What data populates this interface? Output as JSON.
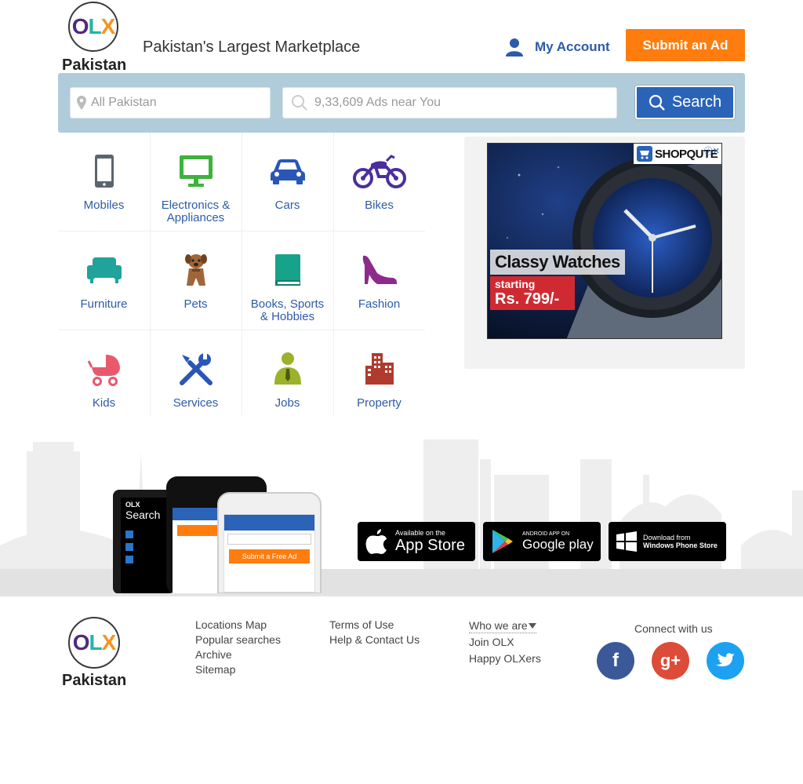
{
  "header": {
    "logo_text": "OLX",
    "country": "Pakistan",
    "tagline": "Pakistan's Largest Marketplace",
    "my_account": "My Account",
    "submit_ad": "Submit an Ad"
  },
  "search": {
    "location_placeholder": "All Pakistan",
    "query_placeholder": "9,33,609 Ads near You",
    "button_label": "Search"
  },
  "categories": [
    {
      "label": "Mobiles",
      "icon": "mobile-icon",
      "color": "#5a6670"
    },
    {
      "label": "Electronics &\nAppliances",
      "icon": "monitor-icon",
      "color": "#3fb23d"
    },
    {
      "label": "Cars",
      "icon": "car-icon",
      "color": "#2a56b6"
    },
    {
      "label": "Bikes",
      "icon": "motorbike-icon",
      "color": "#4b2f9c"
    },
    {
      "label": "Furniture",
      "icon": "sofa-icon",
      "color": "#1fa39a"
    },
    {
      "label": "Pets",
      "icon": "dog-icon",
      "color": "#a0663a"
    },
    {
      "label": "Books, Sports\n& Hobbies",
      "icon": "book-icon",
      "color": "#17a389"
    },
    {
      "label": "Fashion",
      "icon": "high-heel-icon",
      "color": "#8e2a8c"
    },
    {
      "label": "Kids",
      "icon": "stroller-icon",
      "color": "#e8596d"
    },
    {
      "label": "Services",
      "icon": "tools-icon",
      "color": "#2a56b6"
    },
    {
      "label": "Jobs",
      "icon": "worker-icon",
      "color": "#9bb22a"
    },
    {
      "label": "Property",
      "icon": "building-icon",
      "color": "#b03a2e"
    }
  ],
  "ad": {
    "brand": "SHOPQUTE",
    "headline": "Classy Watches",
    "sub": "starting",
    "price": "Rs. 799/-"
  },
  "apps": {
    "phone_search": "Search",
    "phone_submit": "Submit a Free Ad",
    "app_store_small": "Available on the",
    "app_store_big": "App Store",
    "google_small": "ANDROID APP ON",
    "google_big": "Google play",
    "windows_small": "Download from",
    "windows_big": "Windows Phone Store"
  },
  "footer": {
    "links_col1": [
      "Locations Map",
      "Popular searches",
      "Archive",
      "Sitemap"
    ],
    "links_col2": [
      "Terms of Use",
      "Help & Contact Us"
    ],
    "who_we_are": "Who we are",
    "links_col3": [
      "Join OLX",
      "Happy OLXers"
    ],
    "connect": "Connect with us",
    "social": [
      {
        "name": "facebook",
        "glyph": "f",
        "color": "#3b5998"
      },
      {
        "name": "google-plus",
        "glyph": "g+",
        "color": "#dd4b39"
      },
      {
        "name": "twitter",
        "glyph": "t",
        "color": "#1da1f2"
      }
    ]
  }
}
